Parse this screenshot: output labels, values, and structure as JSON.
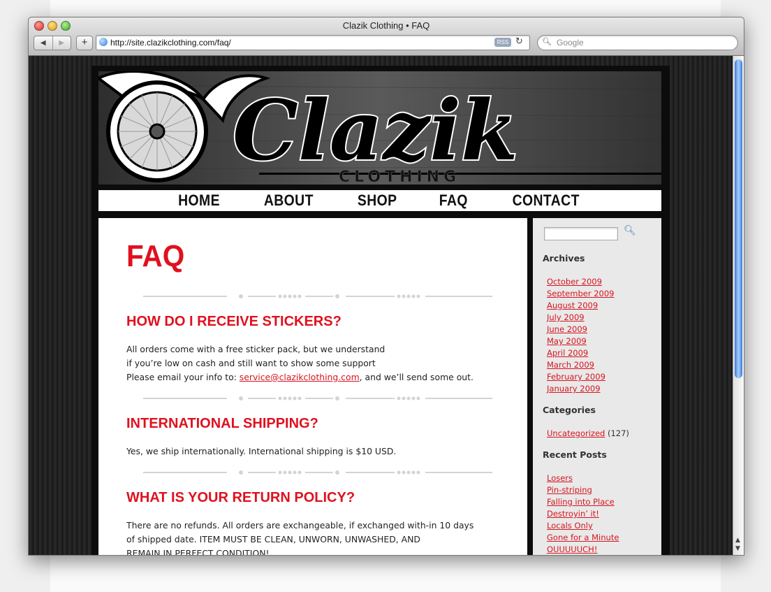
{
  "browser": {
    "title": "Clazik Clothing • FAQ",
    "url": "http://site.clazikclothing.com/faq/",
    "rss_label": "RSS",
    "search_placeholder": "Google",
    "back_glyph": "◀",
    "forward_glyph": "▶",
    "add_glyph": "+",
    "reload_glyph": "↻"
  },
  "site": {
    "logo_text": "Clazik",
    "logo_subtext": "CLOTHING",
    "nav": [
      "HOME",
      "ABOUT",
      "SHOP",
      "FAQ",
      "CONTACT"
    ]
  },
  "page": {
    "title": "FAQ",
    "sections": [
      {
        "question": "HOW DO I RECEIVE STICKERS?",
        "lines": [
          "All orders come with a free sticker pack, but we understand",
          "if you’re low on cash and still want to show some support"
        ],
        "email_prefix": "Please email your info to: ",
        "email": "service@clazikclothing.com",
        "email_suffix": ", and we’ll send some out."
      },
      {
        "question": "INTERNATIONAL SHIPPING?",
        "lines": [
          "Yes, we ship internationally. International shipping is $10 USD."
        ]
      },
      {
        "question": "WHAT IS YOUR RETURN POLICY?",
        "lines": [
          "There are no refunds. All orders are exchangeable, if exchanged with-in 10 days",
          "of shipped date. ITEM MUST BE CLEAN, UNWORN, UNWASHED, AND",
          "REMAIN IN PERFECT CONDITION!"
        ]
      }
    ]
  },
  "sidebar": {
    "archives_title": "Archives",
    "archives": [
      "October 2009",
      "September 2009",
      "August 2009",
      "July 2009",
      "June 2009",
      "May 2009",
      "April 2009",
      "March 2009",
      "February 2009",
      "January 2009"
    ],
    "categories_title": "Categories",
    "categories": [
      {
        "name": "Uncategorized",
        "count": "(127)"
      }
    ],
    "recent_title": "Recent Posts",
    "recent": [
      "Losers",
      "Pin-striping",
      "Falling into Place",
      "Destroyin’ it!",
      "Locals Only",
      "Gone for a Minute",
      "OUUUUUCH!"
    ]
  },
  "colors": {
    "accent_red": "#e0101f",
    "link_red": "#d7141f"
  }
}
